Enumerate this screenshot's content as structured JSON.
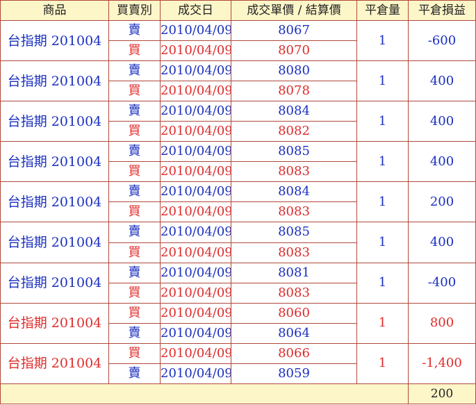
{
  "headers": [
    "商品",
    "買賣別",
    "成交日",
    "成交單價 / 結算價",
    "平倉量",
    "平倉損益"
  ],
  "colors": {
    "blue": "#1a2fbf",
    "red": "#e02a2a",
    "header_bg": "#fdf6c9",
    "border": "#b0483a"
  },
  "groups": [
    {
      "product": "台指期 201004",
      "color": "blue",
      "qty": "1",
      "pnl": "-600",
      "legs": [
        {
          "side": "賣",
          "date": "2010/04/09",
          "price": "8067",
          "color": "blue"
        },
        {
          "side": "買",
          "date": "2010/04/09",
          "price": "8070",
          "color": "red"
        }
      ]
    },
    {
      "product": "台指期 201004",
      "color": "blue",
      "qty": "1",
      "pnl": "400",
      "legs": [
        {
          "side": "賣",
          "date": "2010/04/09",
          "price": "8080",
          "color": "blue"
        },
        {
          "side": "買",
          "date": "2010/04/09",
          "price": "8078",
          "color": "red"
        }
      ]
    },
    {
      "product": "台指期 201004",
      "color": "blue",
      "qty": "1",
      "pnl": "400",
      "legs": [
        {
          "side": "賣",
          "date": "2010/04/09",
          "price": "8084",
          "color": "blue"
        },
        {
          "side": "買",
          "date": "2010/04/09",
          "price": "8082",
          "color": "red"
        }
      ]
    },
    {
      "product": "台指期 201004",
      "color": "blue",
      "qty": "1",
      "pnl": "400",
      "legs": [
        {
          "side": "賣",
          "date": "2010/04/09",
          "price": "8085",
          "color": "blue"
        },
        {
          "side": "買",
          "date": "2010/04/09",
          "price": "8083",
          "color": "red"
        }
      ]
    },
    {
      "product": "台指期 201004",
      "color": "blue",
      "qty": "1",
      "pnl": "200",
      "legs": [
        {
          "side": "賣",
          "date": "2010/04/09",
          "price": "8084",
          "color": "blue"
        },
        {
          "side": "買",
          "date": "2010/04/09",
          "price": "8083",
          "color": "red"
        }
      ]
    },
    {
      "product": "台指期 201004",
      "color": "blue",
      "qty": "1",
      "pnl": "400",
      "legs": [
        {
          "side": "賣",
          "date": "2010/04/09",
          "price": "8085",
          "color": "blue"
        },
        {
          "side": "買",
          "date": "2010/04/09",
          "price": "8083",
          "color": "red"
        }
      ]
    },
    {
      "product": "台指期 201004",
      "color": "blue",
      "qty": "1",
      "pnl": "-400",
      "legs": [
        {
          "side": "賣",
          "date": "2010/04/09",
          "price": "8081",
          "color": "blue"
        },
        {
          "side": "買",
          "date": "2010/04/09",
          "price": "8083",
          "color": "red"
        }
      ]
    },
    {
      "product": "台指期 201004",
      "color": "red",
      "qty": "1",
      "pnl": "800",
      "legs": [
        {
          "side": "買",
          "date": "2010/04/09",
          "price": "8060",
          "color": "red"
        },
        {
          "side": "賣",
          "date": "2010/04/09",
          "price": "8064",
          "color": "blue"
        }
      ]
    },
    {
      "product": "台指期 201004",
      "color": "red",
      "qty": "1",
      "pnl": "-1,400",
      "legs": [
        {
          "side": "買",
          "date": "2010/04/09",
          "price": "8066",
          "color": "red"
        },
        {
          "side": "賣",
          "date": "2010/04/09",
          "price": "8059",
          "color": "blue"
        }
      ]
    }
  ],
  "total": "200"
}
